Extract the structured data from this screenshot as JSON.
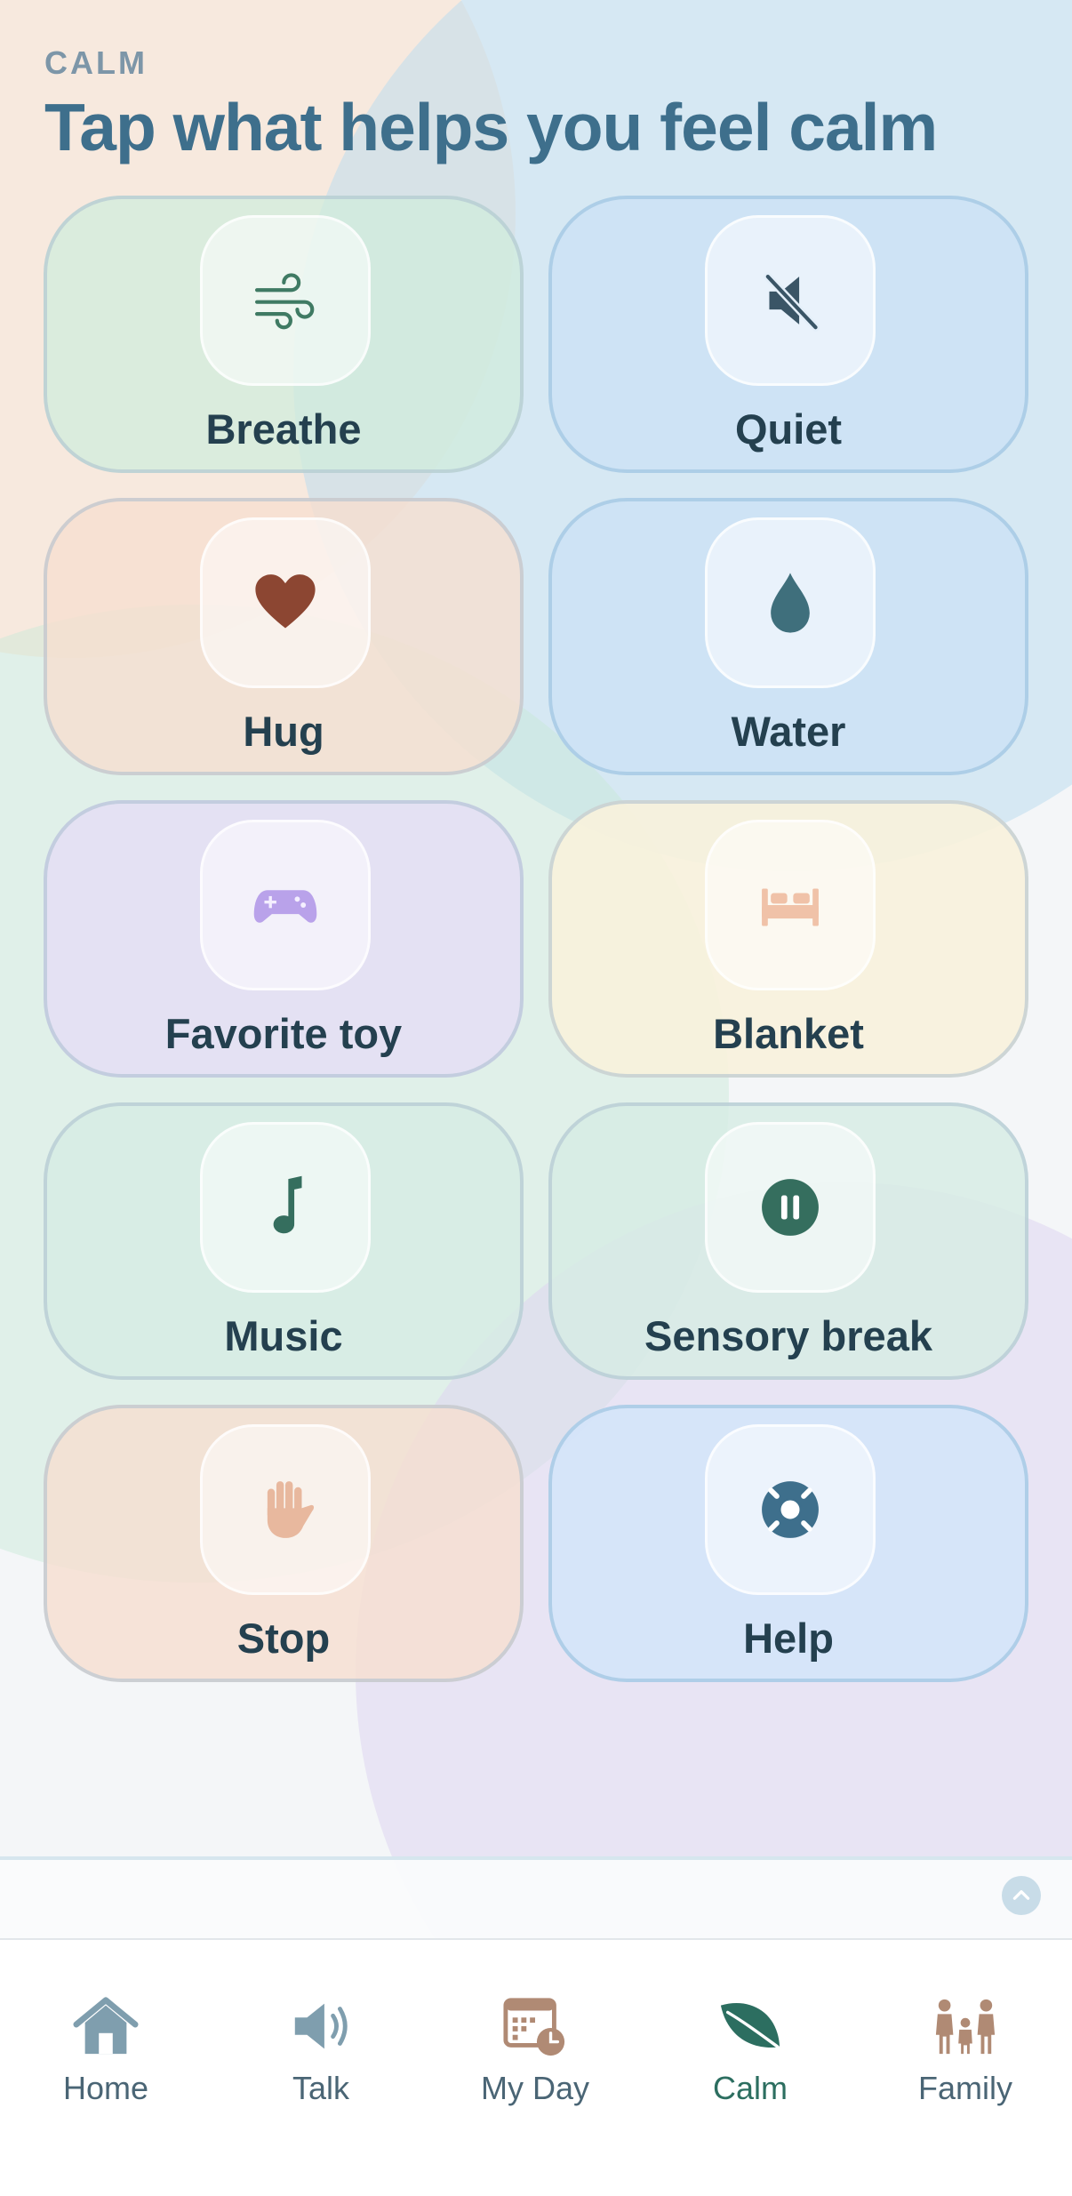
{
  "header": {
    "eyebrow": "CALM",
    "title": "Tap what helps you feel calm"
  },
  "cards": [
    {
      "label": "Breathe",
      "icon": "wind-icon",
      "color": "#3f7a63"
    },
    {
      "label": "Quiet",
      "icon": "mute-icon",
      "color": "#3a5566"
    },
    {
      "label": "Hug",
      "icon": "heart-icon",
      "color": "#8c4632"
    },
    {
      "label": "Water",
      "icon": "water-drop-icon",
      "color": "#3f6f7c"
    },
    {
      "label": "Favorite toy",
      "icon": "gamepad-icon",
      "color": "#b9a2ea"
    },
    {
      "label": "Blanket",
      "icon": "bed-icon",
      "color": "#f0c2a8"
    },
    {
      "label": "Music",
      "icon": "music-note-icon",
      "color": "#356e5e"
    },
    {
      "label": "Sensory break",
      "icon": "pause-icon",
      "color": "#356e5e"
    },
    {
      "label": "Stop",
      "icon": "hand-icon",
      "color": "#e8b89e"
    },
    {
      "label": "Help",
      "icon": "lifebuoy-icon",
      "color": "#3e6f8c"
    }
  ],
  "nav": {
    "active": "Calm",
    "items": [
      {
        "label": "Home",
        "icon": "home-icon"
      },
      {
        "label": "Talk",
        "icon": "speaker-icon"
      },
      {
        "label": "My Day",
        "icon": "calendar-clock-icon"
      },
      {
        "label": "Calm",
        "icon": "leaf-icon"
      },
      {
        "label": "Family",
        "icon": "family-icon"
      }
    ]
  }
}
